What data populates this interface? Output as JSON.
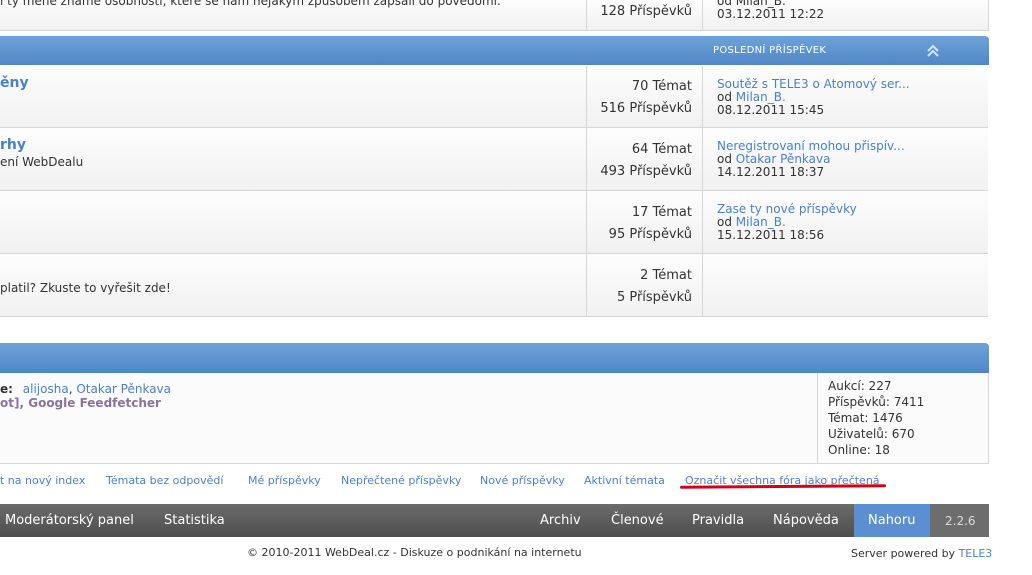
{
  "top_row": {
    "desc": "i ty méně známé osobnosti, které se nám nějakým způsobem zapsali do povědomí.",
    "posts": "128 Příspěvků",
    "last_by": "od Milan_B.",
    "last_date": "03.12.2011 12:22"
  },
  "section_header": {
    "label": "POSLEDNÍ PŘÍSPĚVEK"
  },
  "forums": [
    {
      "title": "ěny",
      "desc": "",
      "topics": "70 Témat",
      "posts": "516 Příspěvků",
      "last_title": "Soutěž s TELE3 o Atomový ser...",
      "last_by_prefix": "od ",
      "last_user": "Milan_B.",
      "last_date": "08.12.2011 15:45"
    },
    {
      "title": "rhy",
      "desc": "ení WebDealu",
      "topics": "64 Témat",
      "posts": "493 Příspěvků",
      "last_title": "Neregistrovaní mohou přispív...",
      "last_by_prefix": "od ",
      "last_user": "Otakar Pěnkava",
      "last_date": "14.12.2011 18:37"
    },
    {
      "title": "",
      "desc": "",
      "topics": "17 Témat",
      "posts": "95 Příspěvků",
      "last_title": "Zase ty nové příspěvky",
      "last_by_prefix": "od ",
      "last_user": "Milan_B.",
      "last_date": "15.12.2011 18:56"
    },
    {
      "title": "",
      "desc": "platil? Zkuste to vyřešit zde!",
      "topics": "2 Témat",
      "posts": "5 Příspěvků",
      "last_title": "",
      "last_by_prefix": "",
      "last_user": "",
      "last_date": ""
    }
  ],
  "online": {
    "prefix": "e:",
    "users": [
      "alijosha",
      "Otakar Pěnkava"
    ],
    "bots_line_1": "ot]",
    "bots_line_2": "Google Feedfetcher"
  },
  "stats": {
    "auctions": "Aukcí: 227",
    "posts": "Příspěvků: 7411",
    "topics": "Témat: 1476",
    "users": "Uživatelů: 670",
    "online": "Online: 18"
  },
  "quick_links": [
    "t na nový index",
    "Témata bez odpovědí",
    "Mé příspěvky",
    "Nepřečtené příspěvky",
    "Nové příspěvky",
    "Aktivní témata",
    "Označit všechna fóra jako přečtená"
  ],
  "nav": {
    "moderator": "Moderátorský panel",
    "stats": "Statistika",
    "archive": "Archiv",
    "members": "Členové",
    "rules": "Pravidla",
    "help": "Nápověda",
    "top": "Nahoru",
    "version": "2.2.6"
  },
  "footer": {
    "copyright": "© 2010-2011 WebDeal.cz - Diskuze o podnikání na internetu",
    "powered_prefix": "Server powered by ",
    "powered_link": "TELE3"
  },
  "colors": {
    "accent": "#4a82c8",
    "annotation": "#d0021b",
    "nav_active": "#5b8fd0"
  }
}
